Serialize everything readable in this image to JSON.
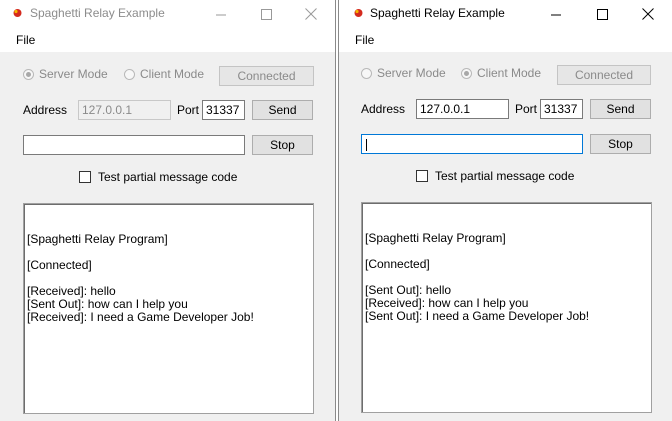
{
  "left": {
    "title": "Spaghetti Relay Example",
    "menu": {
      "file": "File"
    },
    "mode": {
      "server": "Server Mode",
      "client": "Client Mode",
      "selected": "server"
    },
    "connected_label": "Connected",
    "address_label": "Address",
    "address_value": "127.0.0.1",
    "port_label": "Port",
    "port_value": "31337",
    "send_label": "Send",
    "message_value": "",
    "stop_label": "Stop",
    "partial_label": "Test partial message code",
    "log": [
      "[Spaghetti Relay Program]",
      "",
      "[Connected]",
      "",
      "[Received]: hello",
      "[Sent Out]: how can I help you",
      "[Received]: I need a Game Developer Job!"
    ]
  },
  "right": {
    "title": "Spaghetti Relay Example",
    "menu": {
      "file": "File"
    },
    "mode": {
      "server": "Server Mode",
      "client": "Client Mode",
      "selected": "client"
    },
    "connected_label": "Connected",
    "address_label": "Address",
    "address_value": "127.0.0.1",
    "port_label": "Port",
    "port_value": "31337",
    "send_label": "Send",
    "message_value": "",
    "stop_label": "Stop",
    "partial_label": "Test partial message code",
    "log": [
      "[Spaghetti Relay Program]",
      "",
      "[Connected]",
      "",
      "[Sent Out]: hello",
      "[Received]: how can I help you",
      "[Sent Out]: I need a Game Developer Job!"
    ]
  },
  "colors": {
    "focus_border": "#0078d7",
    "disabled_text": "#8a8a8a"
  },
  "icons": {
    "app": "spaghetti-app-icon",
    "minimize": "minimize-icon",
    "maximize": "maximize-icon",
    "close": "close-icon"
  }
}
